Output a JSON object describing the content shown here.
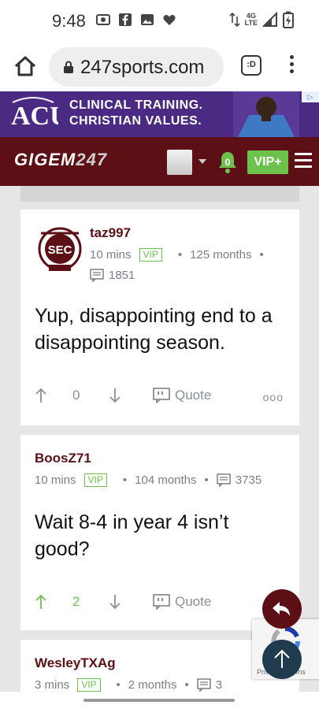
{
  "status": {
    "time": "9:48",
    "network": "4G\nLTE"
  },
  "browser": {
    "url": "247sports.com",
    "tab_label": ":D"
  },
  "ad": {
    "line1": "CLINICAL TRAINING.",
    "line2": "CHRISTIAN VALUES.",
    "logo_text": "ACU"
  },
  "header": {
    "logo_left": "GIGEM",
    "logo_right": "247",
    "notification_count": "0",
    "vip_label": "VIP+"
  },
  "posts": [
    {
      "username": "taz997",
      "time": "10 mins",
      "tag": "VIP",
      "tenure": "125 months",
      "comments": "1851",
      "body": "Yup, disappointing end to a disappointing season.",
      "votes": "0",
      "quote_label": "Quote",
      "more": "ooo"
    },
    {
      "username": "BoosZ71",
      "time": "10 mins",
      "tag": "VIP",
      "tenure": "104 months",
      "comments": "3735",
      "body": "Wait 8-4 in year 4 isn’t good?",
      "votes": "2",
      "quote_label": "Quote"
    },
    {
      "username": "WesleyTXAg",
      "time": "3 mins",
      "tag": "VIP",
      "tenure": "2 months",
      "comments": "3"
    }
  ],
  "recaptcha": {
    "text": "Privacy - Terms"
  },
  "colors": {
    "maroon": "#5c0f14",
    "vip_green": "#6cc24a",
    "ad_purple": "#4b2a83"
  }
}
